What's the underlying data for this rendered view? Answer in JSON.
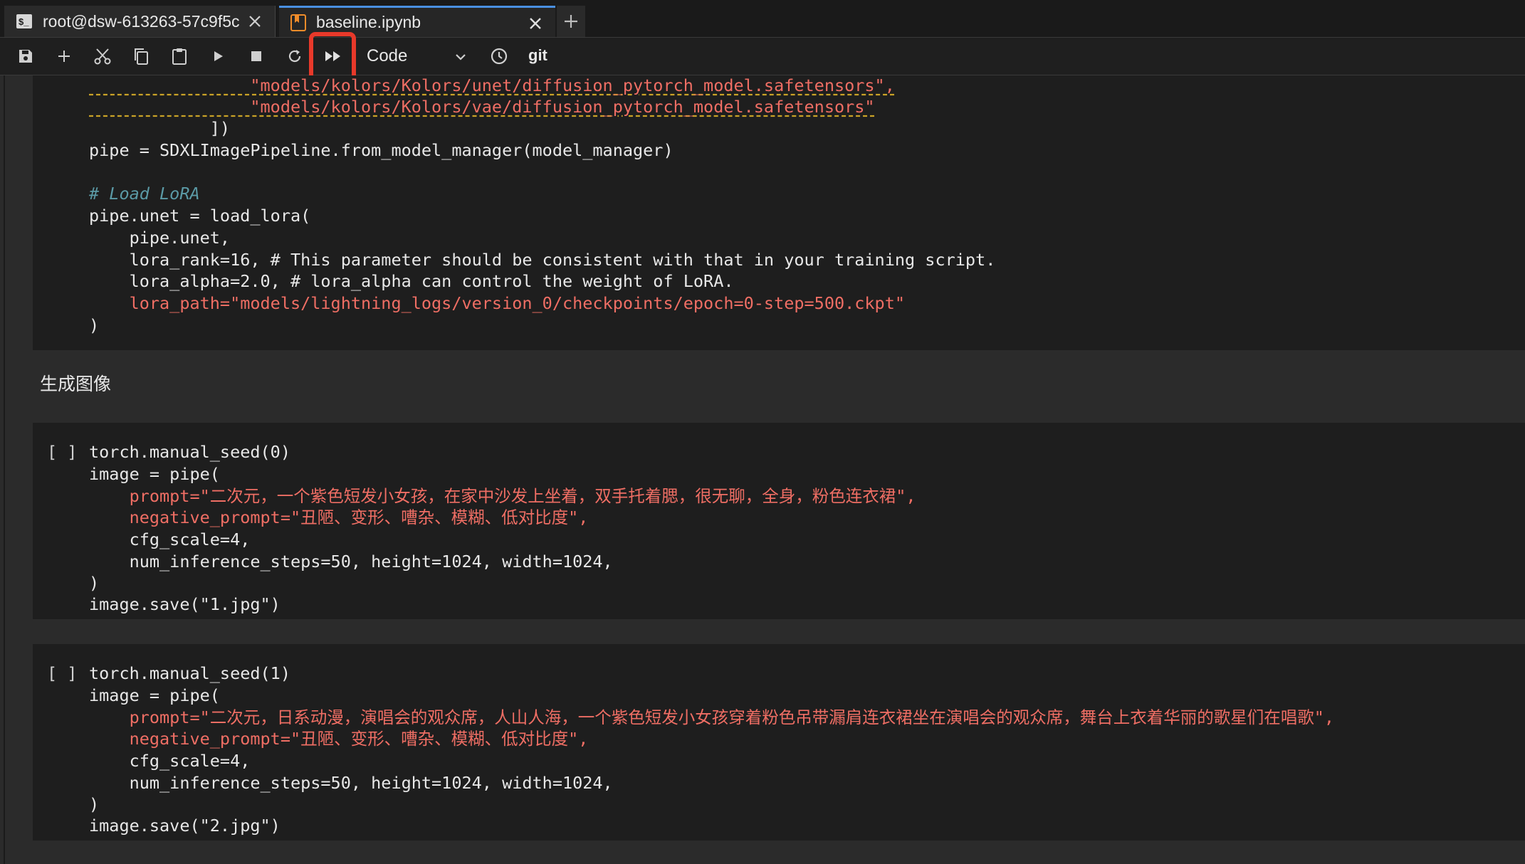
{
  "tabs": [
    {
      "label": "root@dsw-613263-57c9f5c",
      "icon": "terminal-icon",
      "active": false
    },
    {
      "label": "baseline.ipynb",
      "icon": "notebook-icon",
      "active": true
    }
  ],
  "toolbar": {
    "cell_type": "Code",
    "git_label": "git",
    "buttons": [
      "save-icon",
      "add-icon",
      "cut-icon",
      "copy-icon",
      "paste-icon",
      "run-icon",
      "stop-icon",
      "restart-icon",
      "run-all-icon",
      "clock-icon"
    ],
    "highlight_color": "#e8392a"
  },
  "cell1": {
    "lines": [
      "                \"models/kolors/Kolors/unet/diffusion_pytorch_model.safetensors\",",
      "                \"models/kolors/Kolors/vae/diffusion_pytorch_model.safetensors\"",
      "            ])",
      "pipe = SDXLImagePipeline.from_model_manager(model_manager)",
      "",
      "# Load LoRA",
      "pipe.unet = load_lora(",
      "    pipe.unet,",
      "    lora_rank=16, # This parameter should be consistent with that in your training script.",
      "    lora_alpha=2.0, # lora_alpha can control the weight of LoRA.",
      "    lora_path=\"models/lightning_logs/version_0/checkpoints/epoch=0-step=500.ckpt\"",
      ")"
    ]
  },
  "markdown": {
    "heading": "生成图像"
  },
  "cell2": {
    "prompt": "[ ]",
    "lines": [
      "torch.manual_seed(0)",
      "image = pipe(",
      "    prompt=\"二次元，一个紫色短发小女孩，在家中沙发上坐着，双手托着腮，很无聊，全身，粉色连衣裙\",",
      "    negative_prompt=\"丑陋、变形、嘈杂、模糊、低对比度\",",
      "    cfg_scale=4,",
      "    num_inference_steps=50, height=1024, width=1024,",
      ")",
      "image.save(\"1.jpg\")"
    ]
  },
  "cell3": {
    "prompt": "[ ]",
    "lines": [
      "torch.manual_seed(1)",
      "image = pipe(",
      "    prompt=\"二次元，日系动漫，演唱会的观众席，人山人海，一个紫色短发小女孩穿着粉色吊带漏肩连衣裙坐在演唱会的观众席，舞台上衣着华丽的歌星们在唱歌\",",
      "    negative_prompt=\"丑陋、变形、嘈杂、模糊、低对比度\",",
      "    cfg_scale=4,",
      "    num_inference_steps=50, height=1024, width=1024,",
      ")",
      "image.save(\"2.jpg\")"
    ]
  },
  "colors": {
    "string": "#ef6e64",
    "number": "#8ed38f",
    "method": "#5aa9ff",
    "operator": "#c772e0",
    "comment": "#5b9aa6"
  }
}
